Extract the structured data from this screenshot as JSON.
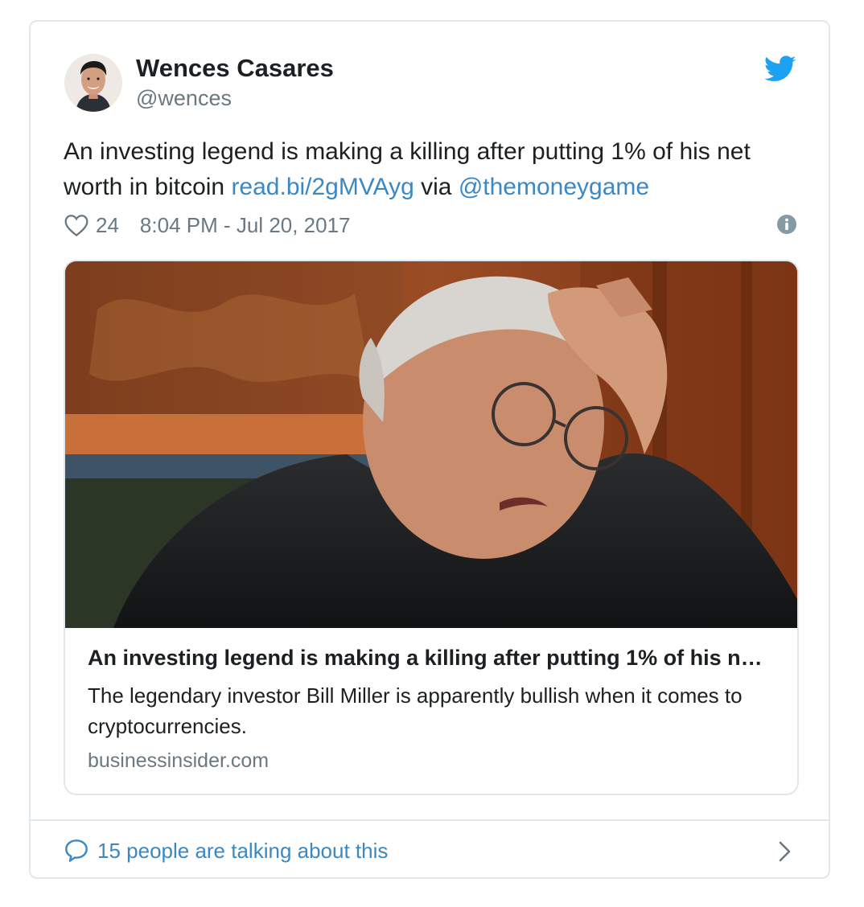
{
  "author": {
    "name": "Wences Casares",
    "handle": "@wences"
  },
  "tweet": {
    "text_before": "An investing legend is making a killing after putting 1% of his net worth in bitcoin ",
    "link": "read.bi/2gMVAyg",
    "via": " via ",
    "mention": "@themoneygame"
  },
  "meta": {
    "likes": "24",
    "timestamp": "8:04 PM - Jul 20, 2017"
  },
  "card": {
    "title": "An investing legend is making a killing after putting 1% of his n…",
    "description": "The legendary investor Bill Miller is apparently bullish when it comes to cryptocurrencies.",
    "domain": "businessinsider.com"
  },
  "footer": {
    "talking": "15 people are talking about this"
  },
  "icons": {
    "brand": "twitter-bird-icon",
    "like": "heart-icon",
    "info": "info-icon",
    "conversation": "speech-bubble-icon",
    "more": "chevron-right-icon"
  },
  "colors": {
    "link": "#3b88c3",
    "brand": "#1da1f2",
    "muted": "#697882",
    "border": "#e1e8ed"
  }
}
